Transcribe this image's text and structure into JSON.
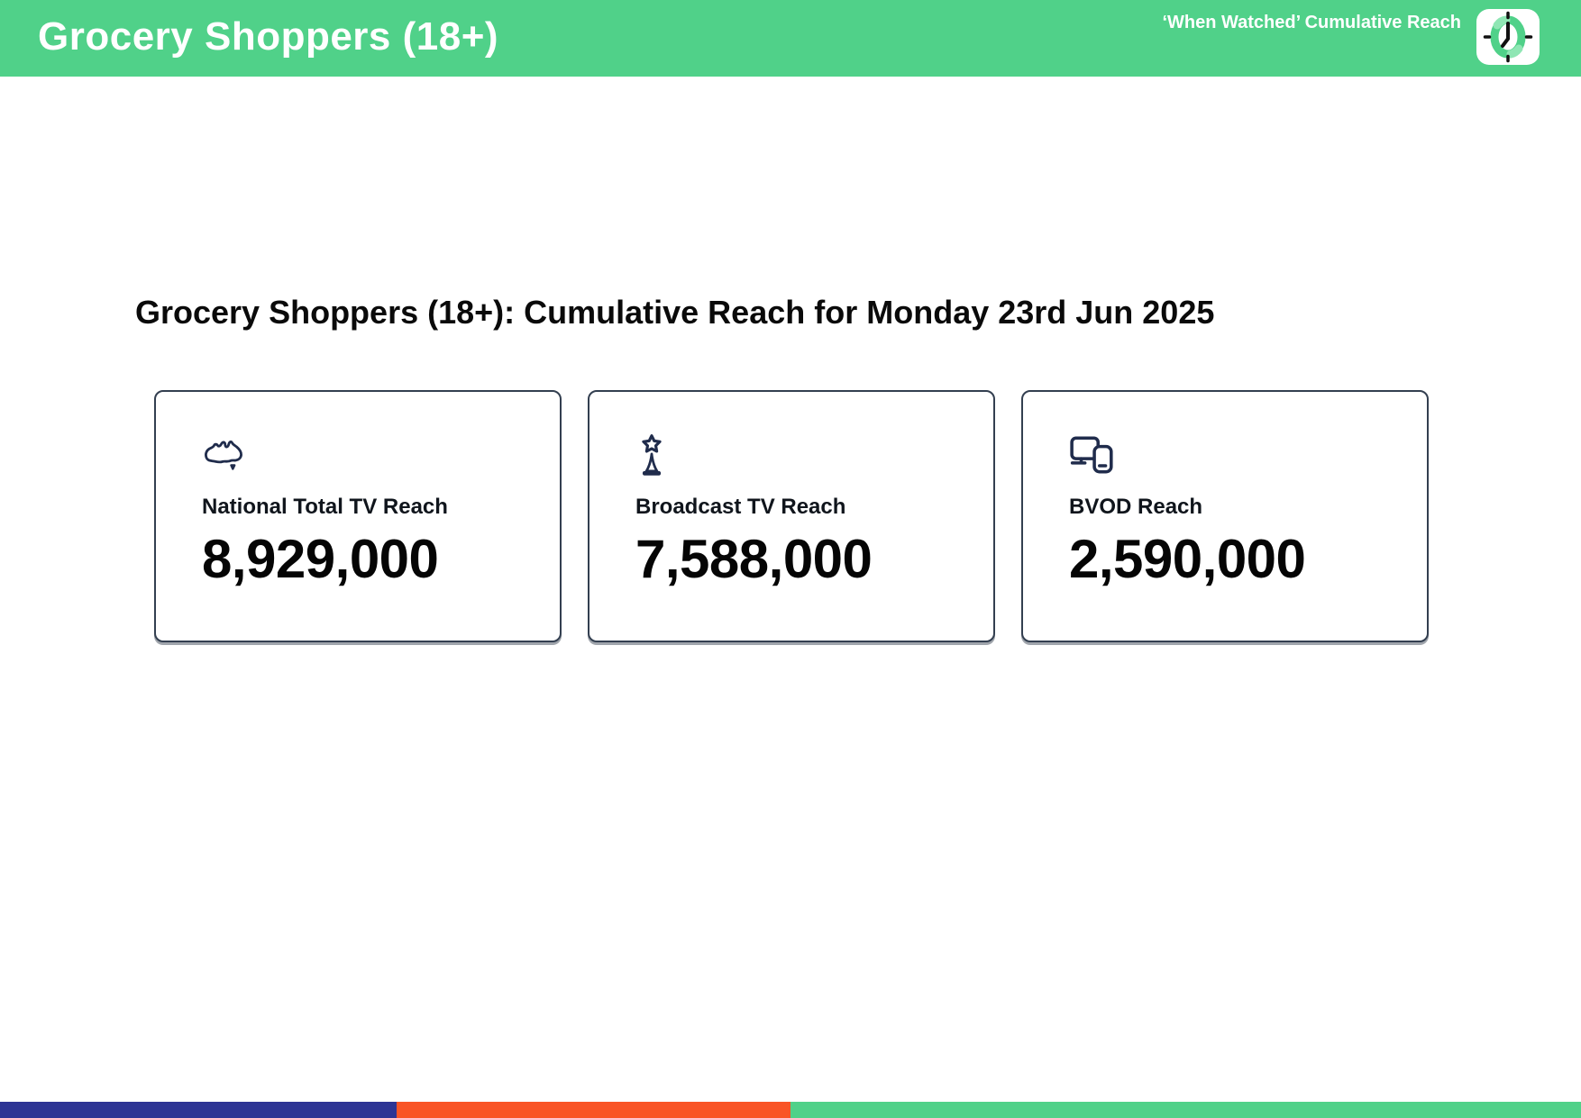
{
  "header": {
    "title": "Grocery Shoppers (18+)",
    "tagline": "‘When Watched’ Cumulative Reach"
  },
  "main": {
    "heading": "Grocery Shoppers (18+): Cumulative Reach for Monday 23rd Jun 2025",
    "cards": [
      {
        "icon": "australia-map-icon",
        "label": "National Total TV Reach",
        "value": "8,929,000"
      },
      {
        "icon": "broadcast-tower-icon",
        "label": "Broadcast TV Reach",
        "value": "7,588,000"
      },
      {
        "icon": "tv-and-phone-devices-icon",
        "label": "BVOD Reach",
        "value": "2,590,000"
      }
    ]
  },
  "footer": {
    "segments": [
      {
        "name": "blue",
        "color": "#2d3494",
        "width_pct": 25.1
      },
      {
        "name": "orange",
        "color": "#f95426",
        "width_pct": 24.9
      },
      {
        "name": "green",
        "color": "#50d189",
        "width_pct": 50.0
      }
    ]
  },
  "colors": {
    "header-green": "#50d189",
    "icon-navy": "#202c4c",
    "card-border": "#333f50",
    "text-black": "#0a0a0a"
  }
}
